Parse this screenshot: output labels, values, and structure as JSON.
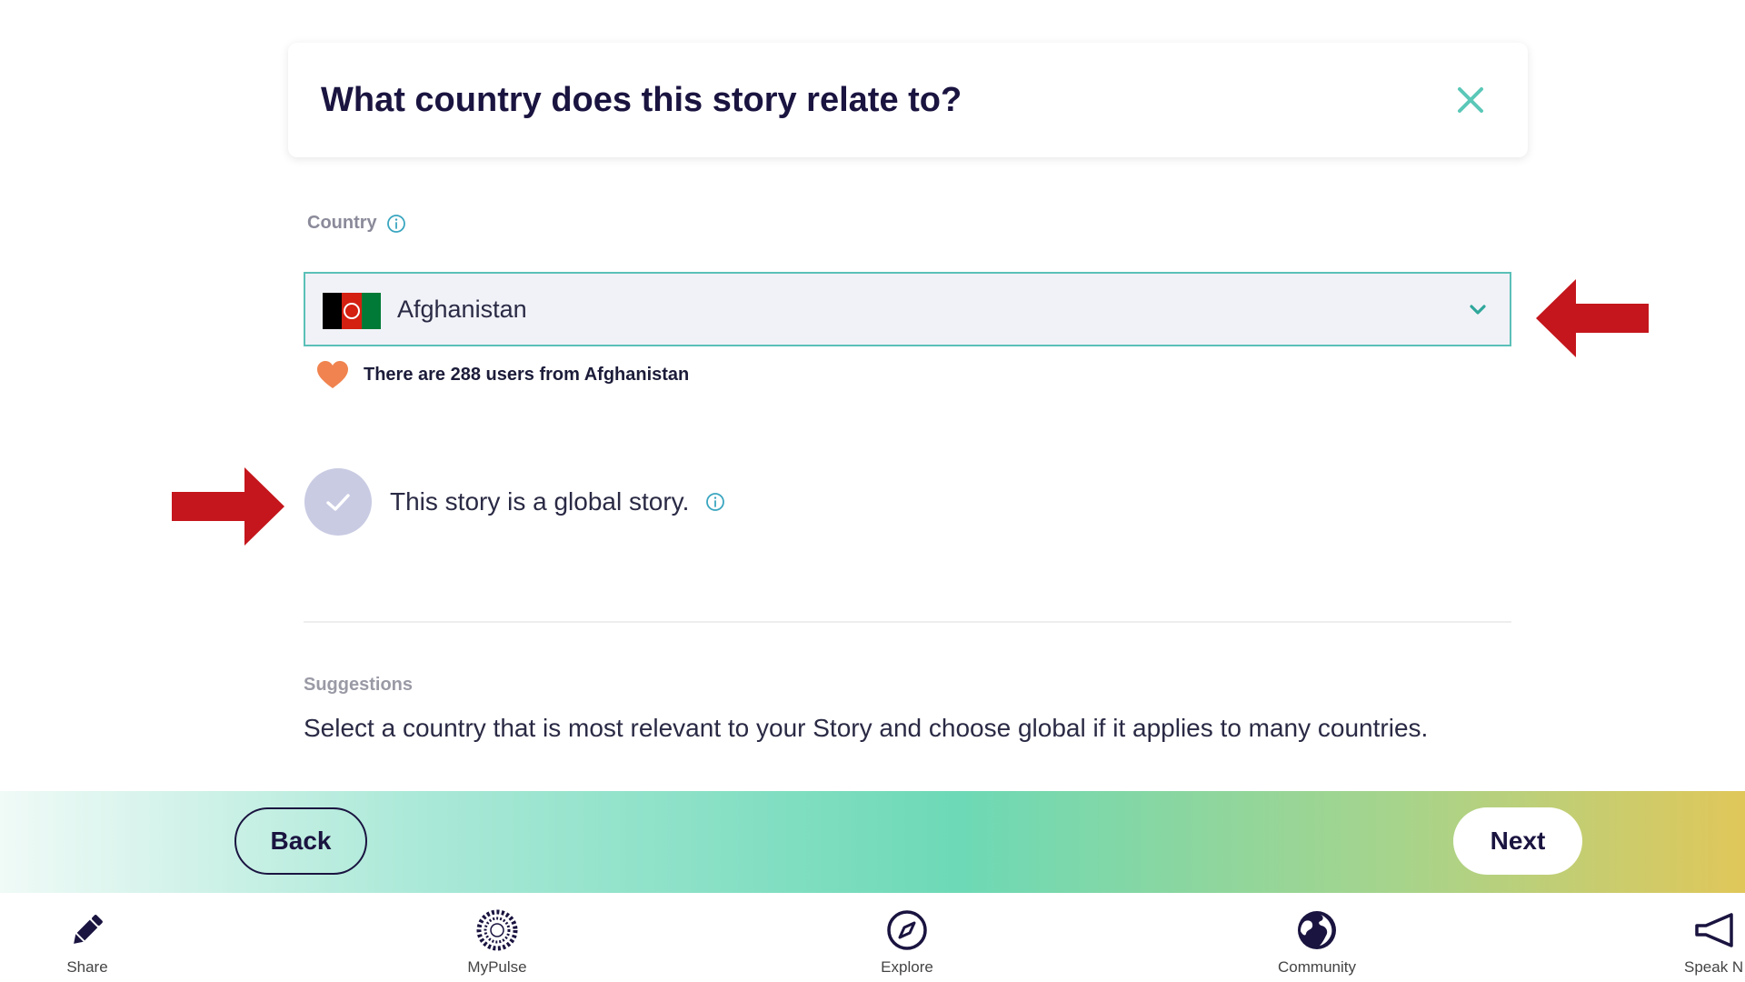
{
  "header": {
    "title": "What country does this story relate to?",
    "close_icon": "close-icon",
    "accent_color": "#5bc8b8"
  },
  "country": {
    "label": "Country",
    "selected": "Afghanistan",
    "flag_icon": "afghanistan-flag-icon",
    "users_note": "There are 288 users from Afghanistan"
  },
  "global": {
    "label": "This story is a global story.",
    "checked": false
  },
  "suggestions": {
    "title": "Suggestions",
    "text": "Select a country that is most relevant to your Story and choose global if it applies to many countries."
  },
  "actions": {
    "back_label": "Back",
    "next_label": "Next"
  },
  "nav": {
    "items": [
      {
        "label": "Share",
        "icon": "pencil-icon"
      },
      {
        "label": "MyPulse",
        "icon": "pulse-icon"
      },
      {
        "label": "Explore",
        "icon": "compass-icon"
      },
      {
        "label": "Community",
        "icon": "globe-icon"
      },
      {
        "label": "Speak N",
        "icon": "megaphone-icon"
      }
    ]
  },
  "colors": {
    "annotation_arrow": "#c4161c",
    "select_border": "#5bc0b8",
    "heart": "#f0834f"
  }
}
